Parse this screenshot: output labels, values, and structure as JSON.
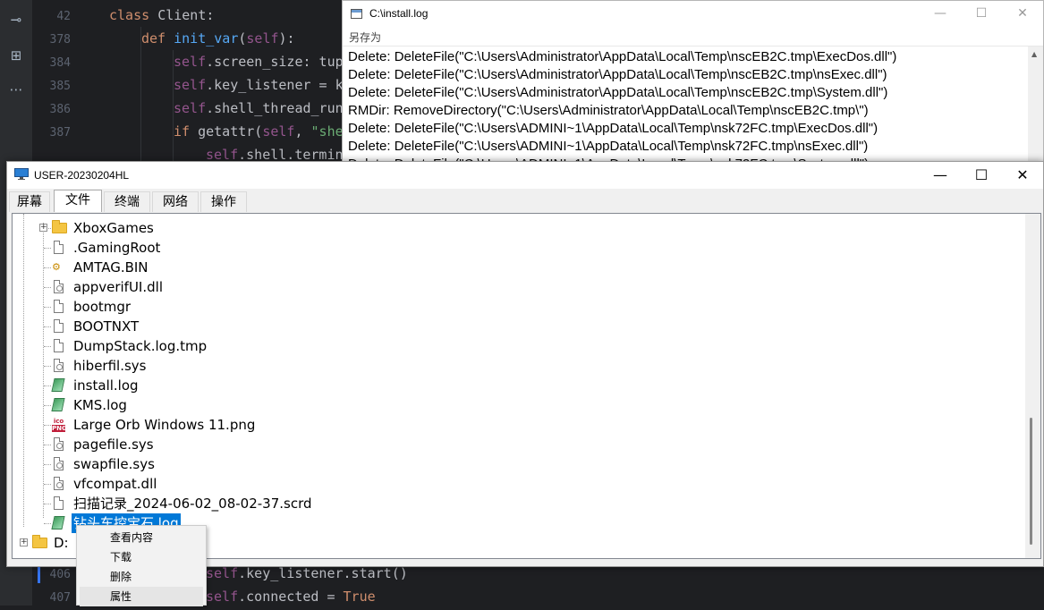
{
  "ide": {
    "sidebar_icons": [
      "commit-icon",
      "structure-icon",
      "more-icon"
    ],
    "lines": [
      {
        "num": "42",
        "parts": [
          {
            "c": "kw",
            "t": "class "
          },
          {
            "c": "tx",
            "t": "Client:"
          }
        ]
      },
      {
        "num": "378",
        "parts": [
          {
            "c": "kw",
            "t": "def "
          },
          {
            "c": "fn",
            "t": "init_var"
          },
          {
            "c": "tx",
            "t": "("
          },
          {
            "c": "slf",
            "t": "self"
          },
          {
            "c": "tx",
            "t": "):"
          }
        ]
      },
      {
        "num": "384",
        "parts": [
          {
            "c": "slf",
            "t": "self"
          },
          {
            "c": "tx",
            "t": ".screen_size: tup"
          }
        ]
      },
      {
        "num": "385",
        "parts": [
          {
            "c": "slf",
            "t": "self"
          },
          {
            "c": "tx",
            "t": ".key_listener = k"
          }
        ]
      },
      {
        "num": "386",
        "parts": [
          {
            "c": "slf",
            "t": "self"
          },
          {
            "c": "tx",
            "t": ".shell_thread_run"
          }
        ]
      },
      {
        "num": "387",
        "parts": [
          {
            "c": "kw",
            "t": "if "
          },
          {
            "c": "tx",
            "t": "getattr("
          },
          {
            "c": "slf",
            "t": "self"
          },
          {
            "c": "tx",
            "t": ", "
          },
          {
            "c": "st",
            "t": "\"she"
          }
        ]
      },
      {
        "num": "",
        "parts": [
          {
            "c": "slf",
            "t": "self"
          },
          {
            "c": "tx",
            "t": ".shell.termin"
          }
        ]
      },
      {
        "num": "406",
        "parts": [
          {
            "c": "slf",
            "t": "self"
          },
          {
            "c": "tx",
            "t": ".key_listener.start()"
          }
        ]
      },
      {
        "num": "407",
        "parts": [
          {
            "c": "slf",
            "t": "self"
          },
          {
            "c": "tx",
            "t": ".connected = "
          },
          {
            "c": "kw",
            "t": "True"
          }
        ]
      }
    ]
  },
  "log_window": {
    "title": "C:\\install.log",
    "menu_saveas": "另存为",
    "lines": [
      "Delete: DeleteFile(\"C:\\Users\\Administrator\\AppData\\Local\\Temp\\nscEB2C.tmp\\ExecDos.dll\")",
      "Delete: DeleteFile(\"C:\\Users\\Administrator\\AppData\\Local\\Temp\\nscEB2C.tmp\\nsExec.dll\")",
      "Delete: DeleteFile(\"C:\\Users\\Administrator\\AppData\\Local\\Temp\\nscEB2C.tmp\\System.dll\")",
      "RMDir: RemoveDirectory(\"C:\\Users\\Administrator\\AppData\\Local\\Temp\\nscEB2C.tmp\\\")",
      "Delete: DeleteFile(\"C:\\Users\\ADMINI~1\\AppData\\Local\\Temp\\nsk72FC.tmp\\ExecDos.dll\")",
      "Delete: DeleteFile(\"C:\\Users\\ADMINI~1\\AppData\\Local\\Temp\\nsk72FC.tmp\\nsExec.dll\")",
      "Delete: DeleteFile(\"C:\\Users\\ADMINI~1\\AppData\\Local\\Temp\\nsk72FC.tmp\\System.dll\")"
    ]
  },
  "main_window": {
    "title": "USER-20230204HL",
    "controls": {
      "minimize": "—",
      "maximize": "☐",
      "close": "✕"
    },
    "tabs": [
      "屏幕",
      "文件",
      "终端",
      "网络",
      "操作"
    ],
    "active_tab": "文件",
    "tree": [
      {
        "label": "XboxGames",
        "icon": "folder-icon",
        "expander": "+"
      },
      {
        "label": ".GamingRoot",
        "icon": "file-icon"
      },
      {
        "label": "AMTAG.BIN",
        "icon": "bin-file-icon"
      },
      {
        "label": "appverifUI.dll",
        "icon": "system-file-icon"
      },
      {
        "label": "bootmgr",
        "icon": "file-icon"
      },
      {
        "label": "BOOTNXT",
        "icon": "file-icon"
      },
      {
        "label": "DumpStack.log.tmp",
        "icon": "text-file-icon"
      },
      {
        "label": "hiberfil.sys",
        "icon": "system-file-icon"
      },
      {
        "label": "install.log",
        "icon": "log-file-icon"
      },
      {
        "label": "KMS.log",
        "icon": "log-file-icon"
      },
      {
        "label": "Large Orb Windows 11.png",
        "icon": "png-file-icon"
      },
      {
        "label": "pagefile.sys",
        "icon": "system-file-icon"
      },
      {
        "label": "swapfile.sys",
        "icon": "system-file-icon"
      },
      {
        "label": "vfcompat.dll",
        "icon": "system-file-icon"
      },
      {
        "label": "扫描记录_2024-06-02_08-02-37.scrd",
        "icon": "file-icon"
      },
      {
        "label": "钻头车控宝石.log",
        "icon": "log-file-icon",
        "selected": true
      }
    ],
    "drive": {
      "label": "D:",
      "icon": "folder-icon",
      "expander": "+"
    }
  },
  "context_menu": {
    "items": [
      "查看内容",
      "下载",
      "删除",
      "属性"
    ],
    "hover_item": "属性"
  },
  "colors": {
    "selection": "#0078d7",
    "ide_bg": "#1e1f22"
  }
}
